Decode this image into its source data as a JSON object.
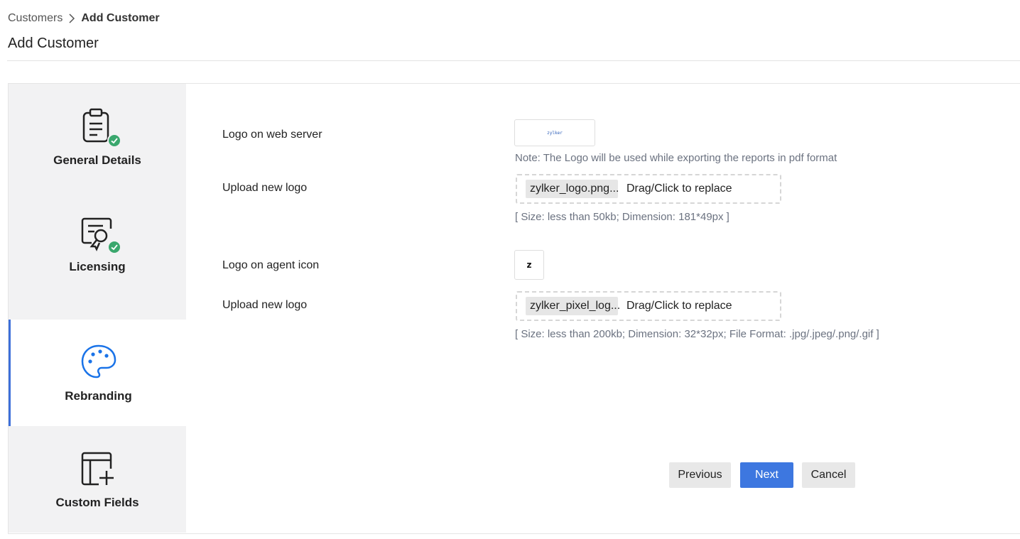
{
  "breadcrumb": {
    "parent": "Customers",
    "current": "Add Customer"
  },
  "page_title": "Add Customer",
  "steps": [
    {
      "label": "General Details",
      "icon": "clipboard-icon",
      "completed": true
    },
    {
      "label": "Licensing",
      "icon": "license-certificate-icon",
      "completed": true
    },
    {
      "label": "Rebranding",
      "icon": "palette-icon",
      "active": true
    },
    {
      "label": "Custom Fields",
      "icon": "table-add-icon"
    }
  ],
  "web_logo": {
    "label": "Logo on web server",
    "preview_text": "zylker",
    "note": "Note: The Logo will be used while exporting the reports in pdf format",
    "upload_label": "Upload new logo",
    "file_name": "zylker_logo.png...",
    "drop_text": "Drag/Click to replace",
    "hint": "[ Size: less than 50kb; Dimension: 181*49px ]"
  },
  "agent_logo": {
    "label": "Logo on agent icon",
    "preview_text": "z",
    "upload_label": "Upload new logo",
    "file_name": "zylker_pixel_log...",
    "drop_text": "Drag/Click to replace",
    "hint": "[ Size: less than 200kb;   Dimension: 32*32px;   File Format: .jpg/.jpeg/.png/.gif ]"
  },
  "buttons": {
    "previous": "Previous",
    "next": "Next",
    "cancel": "Cancel"
  },
  "colors": {
    "accent": "#3d77e0",
    "success": "#3aa76d",
    "active_border": "#3d6fd9",
    "icon_blue": "#1a73e8"
  }
}
